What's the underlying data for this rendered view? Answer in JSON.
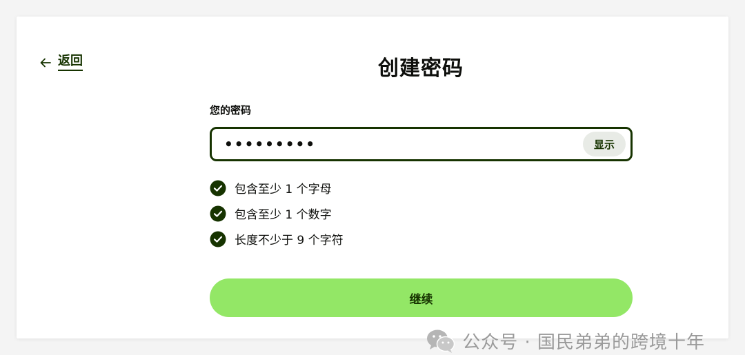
{
  "header": {
    "back_label": "返回",
    "title": "创建密码"
  },
  "form": {
    "password_label": "您的密码",
    "password_value": "•••••••••",
    "show_label": "显示",
    "rules": [
      {
        "text": "包含至少 1 个字母",
        "met": true
      },
      {
        "text": "包含至少 1 个数字",
        "met": true
      },
      {
        "text": "长度不少于 9 个字符",
        "met": true
      }
    ],
    "continue_label": "继续"
  },
  "watermark": {
    "text": "公众号 · 国民弟弟的跨境十年"
  },
  "colors": {
    "primary_dark": "#163300",
    "accent_green": "#93e766",
    "show_button_bg": "#e8ebe6"
  },
  "icons": {
    "back": "arrow-left-icon",
    "check": "check-circle-icon",
    "wechat": "wechat-icon"
  }
}
